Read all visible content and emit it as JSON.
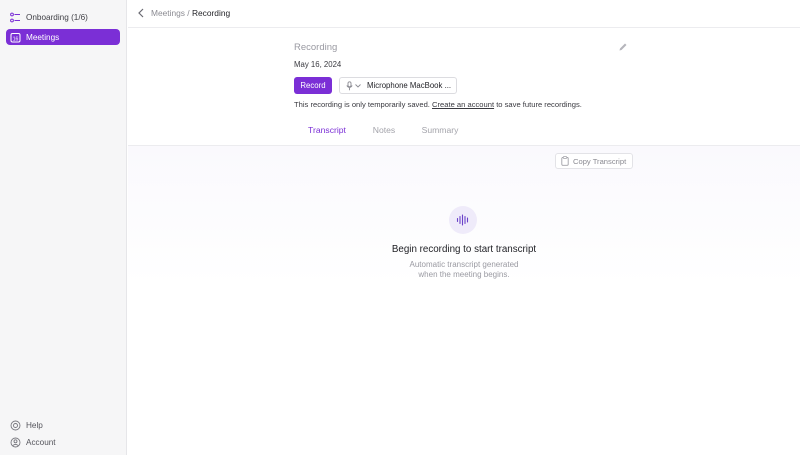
{
  "sidebar": {
    "onboarding_label": "Onboarding (1/6)",
    "meetings_label": "Meetings",
    "help_label": "Help",
    "account_label": "Account"
  },
  "header": {
    "breadcrumb_parent": "Meetings",
    "breadcrumb_sep": " / ",
    "breadcrumb_current": "Recording"
  },
  "recording": {
    "title": "Recording",
    "date": "May 16, 2024",
    "record_button": "Record",
    "microphone": "Microphone MacBook ...",
    "notice_prefix": "This recording is only temporarily saved. ",
    "notice_link": "Create an account",
    "notice_suffix": " to save future recordings."
  },
  "tabs": [
    {
      "label": "Transcript",
      "active": true
    },
    {
      "label": "Notes",
      "active": false
    },
    {
      "label": "Summary",
      "active": false
    }
  ],
  "transcript": {
    "copy_button": "Copy Transcript",
    "empty_title": "Begin recording to start transcript",
    "empty_line1": "Automatic transcript generated",
    "empty_line2": "when the meeting begins."
  },
  "colors": {
    "accent": "#7b2fd6",
    "sidebar_bg": "#f6f6f7"
  },
  "icons": [
    "checklist-icon",
    "calendar-icon",
    "help-icon",
    "account-icon",
    "back-chevron-icon",
    "pencil-icon",
    "microphone-icon",
    "chevron-down-icon",
    "clipboard-icon",
    "waveform-icon"
  ]
}
